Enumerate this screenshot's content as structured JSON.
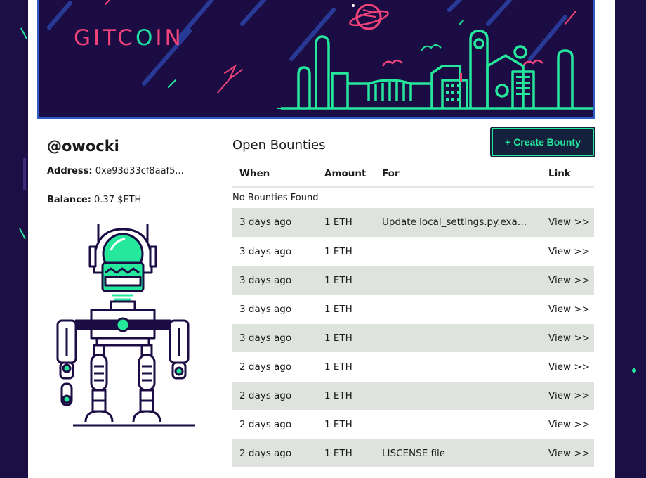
{
  "brand": {
    "logo_text_1": "GITC",
    "logo_text_o": "O",
    "logo_text_2": "IN"
  },
  "profile": {
    "username": "@owocki",
    "address_label": "Address:",
    "address_value": "0xe93d33cf8aaf5...",
    "balance_label": "Balance:",
    "balance_value": "0.37 $ETH"
  },
  "bounties": {
    "title": "Open Bounties",
    "create_button": "+ Create Bounty",
    "columns": [
      "When",
      "Amount",
      "For",
      "Link"
    ],
    "empty_text": "No Bounties Found",
    "rows": [
      {
        "when": "3 days ago",
        "amount": "1 ETH",
        "for": "Update local_settings.py.examp...",
        "link": "View >>"
      },
      {
        "when": "3 days ago",
        "amount": "1 ETH",
        "for": "",
        "link": "View >>"
      },
      {
        "when": "3 days ago",
        "amount": "1 ETH",
        "for": "",
        "link": "View >>"
      },
      {
        "when": "3 days ago",
        "amount": "1 ETH",
        "for": "",
        "link": "View >>"
      },
      {
        "when": "3 days ago",
        "amount": "1 ETH",
        "for": "",
        "link": "View >>"
      },
      {
        "when": "2 days ago",
        "amount": "1 ETH",
        "for": "",
        "link": "View >>"
      },
      {
        "when": "2 days ago",
        "amount": "1 ETH",
        "for": "",
        "link": "View >>"
      },
      {
        "when": "2 days ago",
        "amount": "1 ETH",
        "for": "",
        "link": "View >>"
      },
      {
        "when": "2 days ago",
        "amount": "1 ETH",
        "for": "LISCENSE file",
        "link": "View >>"
      }
    ]
  },
  "colors": {
    "accent_green": "#25e89d",
    "brand_pink": "#f0437a",
    "navy": "#1b0c44",
    "row_alt": "#dfe3dd"
  },
  "icons": [
    "planet-icon",
    "city-skyline-illustration",
    "robot-illustration"
  ]
}
